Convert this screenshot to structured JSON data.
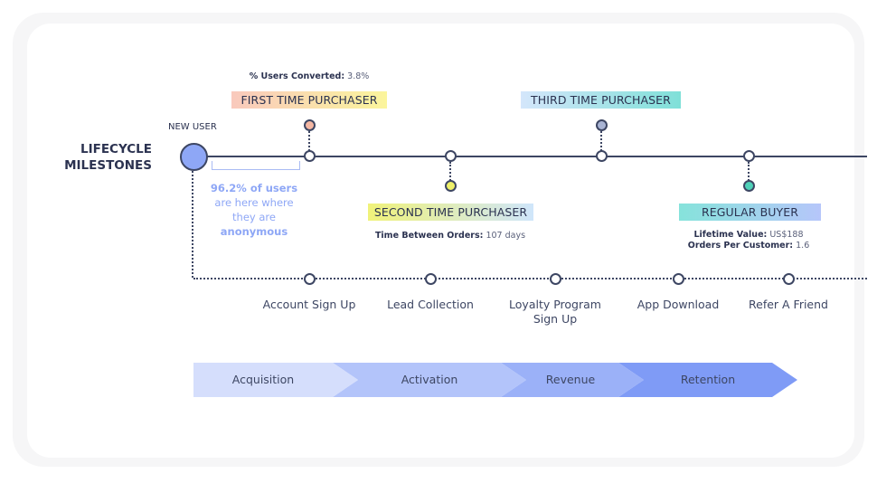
{
  "diagram": {
    "title_line1": "LIFECYCLE",
    "title_line2": "MILESTONES",
    "new_user_label": "NEW USER",
    "anonymous_note": {
      "line1": "96.2% of users",
      "line2": "are here where",
      "line3": "they are",
      "line4": "anonymous"
    },
    "milestones": [
      {
        "label": "FIRST TIME PURCHASER",
        "position": "above",
        "dot_color": "#f4b7a3",
        "tag_gradient": [
          "#f9c9bd",
          "#fbf59c"
        ],
        "stats": [
          {
            "key": "% Users Converted:",
            "value": "3.8%"
          }
        ]
      },
      {
        "label": "SECOND TIME PURCHASER",
        "position": "below",
        "dot_color": "#eef06a",
        "tag_gradient": [
          "#f0f27a",
          "#cfe6fb"
        ],
        "stats": [
          {
            "key": "Time Between Orders:",
            "value": "107 days"
          }
        ]
      },
      {
        "label": "THIRD TIME PURCHASER",
        "position": "above",
        "dot_color": "#a9b4d4",
        "tag_gradient": [
          "#d4e6fb",
          "#7fe0d8"
        ],
        "stats": []
      },
      {
        "label": "REGULAR BUYER",
        "position": "below",
        "dot_color": "#4fd1b8",
        "tag_gradient": [
          "#86e3db",
          "#b6c6fa"
        ],
        "stats": [
          {
            "key": "Lifetime Value:",
            "value": "US$188"
          },
          {
            "key": "Orders Per Customer:",
            "value": "1.6"
          }
        ]
      }
    ],
    "actions": [
      {
        "line1": "Account Sign Up",
        "line2": ""
      },
      {
        "line1": "Lead Collection",
        "line2": ""
      },
      {
        "line1": "Loyalty Program",
        "line2": "Sign Up"
      },
      {
        "line1": "App Download",
        "line2": ""
      },
      {
        "line1": "Refer A Friend",
        "line2": ""
      }
    ],
    "stages": [
      {
        "label": "Acquisition",
        "color": "#d5defc"
      },
      {
        "label": "Activation",
        "color": "#b3c4fa"
      },
      {
        "label": "Revenue",
        "color": "#9bb1f8"
      },
      {
        "label": "Retention",
        "color": "#7f9bf6"
      }
    ],
    "colors": {
      "line": "#3d4663",
      "new_user_node": "#8ea7f6",
      "accent_text": "#8ea7f6"
    }
  }
}
